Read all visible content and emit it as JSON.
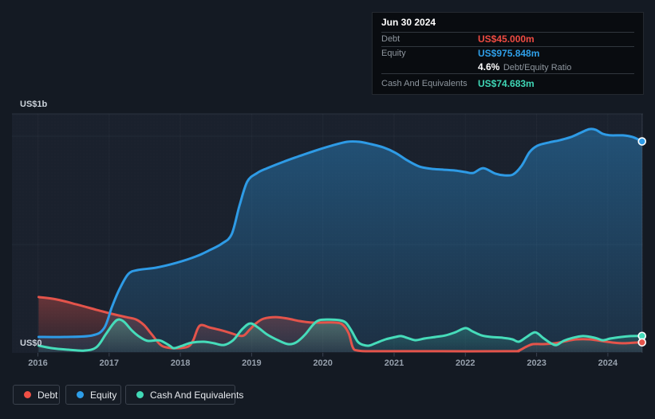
{
  "axis": {
    "y_max": "US$1b",
    "y_min": "US$0",
    "years": [
      "2016",
      "2017",
      "2018",
      "2019",
      "2020",
      "2021",
      "2022",
      "2023",
      "2024"
    ]
  },
  "tooltip": {
    "date": "Jun 30 2024",
    "debt_label": "Debt",
    "debt_value": "US$45.000m",
    "equity_label": "Equity",
    "equity_value": "US$975.848m",
    "ratio_value": "4.6%",
    "ratio_label": "Debt/Equity Ratio",
    "cash_label": "Cash And Equivalents",
    "cash_value": "US$74.683m"
  },
  "legend": {
    "items": [
      {
        "label": "Debt",
        "color": "#ef4f45"
      },
      {
        "label": "Equity",
        "color": "#2d9de8"
      },
      {
        "label": "Cash And Equivalents",
        "color": "#41d9b5"
      }
    ]
  },
  "colors": {
    "debt": "#e4544b",
    "equity": "#2e9be6",
    "cash": "#46dcba",
    "debt_text": "#ef4b42",
    "equity_text": "#2f9fe8",
    "cash_text": "#3fd6b5",
    "background": "#141a23",
    "plot_background": "#1a212d",
    "gridline": "#232b37",
    "top_gridline": "#2c3440",
    "axis_line": "#3a4351"
  },
  "chart_data": {
    "type": "area",
    "title": "Debt to Equity history",
    "xlabel": "",
    "ylabel": "",
    "x_ticks": [
      "2016",
      "2017",
      "2018",
      "2019",
      "2020",
      "2021",
      "2022",
      "2023",
      "2024"
    ],
    "y_axis": {
      "min_m": 0,
      "max_m": 1000,
      "min_label": "US$0",
      "max_label": "US$1b"
    },
    "legend_position": "bottom",
    "grid": "horizontal-faint",
    "hover_point": {
      "date": "Jun 30 2024",
      "debt_m": 45.0,
      "equity_m": 975.848,
      "debt_equity_ratio_pct": 4.6,
      "cash_m": 74.683
    },
    "series": [
      {
        "name": "Equity",
        "units": "US$m",
        "points": [
          [
            2016.01,
            70
          ],
          [
            2016.37,
            70
          ],
          [
            2016.76,
            77
          ],
          [
            2016.93,
            111
          ],
          [
            2017.04,
            210
          ],
          [
            2017.15,
            295
          ],
          [
            2017.27,
            362
          ],
          [
            2017.4,
            380
          ],
          [
            2017.66,
            391
          ],
          [
            2017.94,
            413
          ],
          [
            2018.22,
            443
          ],
          [
            2018.41,
            472
          ],
          [
            2018.58,
            502
          ],
          [
            2018.72,
            546
          ],
          [
            2018.83,
            679
          ],
          [
            2018.94,
            790
          ],
          [
            2019.08,
            830
          ],
          [
            2019.22,
            852
          ],
          [
            2019.45,
            882
          ],
          [
            2019.67,
            908
          ],
          [
            2019.9,
            934
          ],
          [
            2020.12,
            956
          ],
          [
            2020.34,
            974
          ],
          [
            2020.51,
            974
          ],
          [
            2020.68,
            963
          ],
          [
            2020.85,
            948
          ],
          [
            2021.02,
            923
          ],
          [
            2021.18,
            889
          ],
          [
            2021.35,
            860
          ],
          [
            2021.52,
            849
          ],
          [
            2021.69,
            845
          ],
          [
            2021.86,
            841
          ],
          [
            2022.0,
            834
          ],
          [
            2022.11,
            830
          ],
          [
            2022.25,
            852
          ],
          [
            2022.42,
            827
          ],
          [
            2022.55,
            819
          ],
          [
            2022.67,
            823
          ],
          [
            2022.79,
            863
          ],
          [
            2022.9,
            926
          ],
          [
            2023.01,
            956
          ],
          [
            2023.17,
            971
          ],
          [
            2023.33,
            982
          ],
          [
            2023.48,
            996
          ],
          [
            2023.63,
            1018
          ],
          [
            2023.74,
            1033
          ],
          [
            2023.83,
            1030
          ],
          [
            2023.93,
            1011
          ],
          [
            2024.04,
            1004
          ],
          [
            2024.21,
            1004
          ],
          [
            2024.35,
            996
          ],
          [
            2024.48,
            975.848
          ]
        ]
      },
      {
        "name": "Debt",
        "units": "US$m",
        "points": [
          [
            2016.01,
            255
          ],
          [
            2016.26,
            244
          ],
          [
            2016.54,
            221
          ],
          [
            2016.82,
            196
          ],
          [
            2017.04,
            177
          ],
          [
            2017.24,
            162
          ],
          [
            2017.38,
            151
          ],
          [
            2017.49,
            125
          ],
          [
            2017.6,
            81
          ],
          [
            2017.71,
            37
          ],
          [
            2017.8,
            22
          ],
          [
            2017.96,
            18
          ],
          [
            2018.11,
            26
          ],
          [
            2018.18,
            55
          ],
          [
            2018.27,
            122
          ],
          [
            2018.41,
            114
          ],
          [
            2018.55,
            103
          ],
          [
            2018.7,
            89
          ],
          [
            2018.81,
            77
          ],
          [
            2018.89,
            77
          ],
          [
            2018.97,
            103
          ],
          [
            2019.06,
            133
          ],
          [
            2019.17,
            155
          ],
          [
            2019.34,
            162
          ],
          [
            2019.51,
            155
          ],
          [
            2019.67,
            144
          ],
          [
            2019.84,
            137
          ],
          [
            2020.01,
            137
          ],
          [
            2020.16,
            137
          ],
          [
            2020.27,
            129
          ],
          [
            2020.36,
            89
          ],
          [
            2020.42,
            22
          ],
          [
            2020.49,
            7
          ],
          [
            2020.74,
            4
          ],
          [
            2021.63,
            4
          ],
          [
            2022.64,
            4
          ],
          [
            2022.75,
            7
          ],
          [
            2022.86,
            26
          ],
          [
            2022.95,
            37
          ],
          [
            2023.09,
            37
          ],
          [
            2023.26,
            41
          ],
          [
            2023.43,
            52
          ],
          [
            2023.56,
            59
          ],
          [
            2023.74,
            59
          ],
          [
            2023.9,
            52
          ],
          [
            2024.08,
            44
          ],
          [
            2024.23,
            41
          ],
          [
            2024.38,
            44
          ],
          [
            2024.48,
            45
          ]
        ]
      },
      {
        "name": "Cash And Equivalents",
        "units": "US$m",
        "points": [
          [
            2016.01,
            30
          ],
          [
            2016.2,
            18
          ],
          [
            2016.43,
            11
          ],
          [
            2016.65,
            7
          ],
          [
            2016.82,
            22
          ],
          [
            2016.95,
            81
          ],
          [
            2017.06,
            133
          ],
          [
            2017.13,
            151
          ],
          [
            2017.21,
            140
          ],
          [
            2017.32,
            100
          ],
          [
            2017.43,
            70
          ],
          [
            2017.54,
            52
          ],
          [
            2017.67,
            55
          ],
          [
            2017.73,
            52
          ],
          [
            2017.85,
            30
          ],
          [
            2017.91,
            18
          ],
          [
            2018.03,
            30
          ],
          [
            2018.16,
            44
          ],
          [
            2018.33,
            48
          ],
          [
            2018.47,
            41
          ],
          [
            2018.61,
            33
          ],
          [
            2018.74,
            55
          ],
          [
            2018.87,
            107
          ],
          [
            2018.98,
            133
          ],
          [
            2019.09,
            114
          ],
          [
            2019.22,
            81
          ],
          [
            2019.37,
            55
          ],
          [
            2019.51,
            37
          ],
          [
            2019.62,
            44
          ],
          [
            2019.75,
            81
          ],
          [
            2019.86,
            126
          ],
          [
            2019.95,
            148
          ],
          [
            2020.09,
            151
          ],
          [
            2020.23,
            148
          ],
          [
            2020.32,
            137
          ],
          [
            2020.4,
            100
          ],
          [
            2020.49,
            48
          ],
          [
            2020.57,
            33
          ],
          [
            2020.65,
            30
          ],
          [
            2020.76,
            44
          ],
          [
            2020.88,
            59
          ],
          [
            2021.02,
            70
          ],
          [
            2021.1,
            74
          ],
          [
            2021.21,
            63
          ],
          [
            2021.3,
            55
          ],
          [
            2021.43,
            63
          ],
          [
            2021.58,
            70
          ],
          [
            2021.72,
            77
          ],
          [
            2021.86,
            92
          ],
          [
            2022.0,
            111
          ],
          [
            2022.1,
            96
          ],
          [
            2022.23,
            77
          ],
          [
            2022.36,
            70
          ],
          [
            2022.53,
            66
          ],
          [
            2022.66,
            59
          ],
          [
            2022.75,
            48
          ],
          [
            2022.86,
            70
          ],
          [
            2022.98,
            92
          ],
          [
            2023.09,
            66
          ],
          [
            2023.2,
            41
          ],
          [
            2023.28,
            33
          ],
          [
            2023.38,
            52
          ],
          [
            2023.51,
            66
          ],
          [
            2023.65,
            74
          ],
          [
            2023.76,
            70
          ],
          [
            2023.85,
            63
          ],
          [
            2023.93,
            55
          ],
          [
            2024.04,
            63
          ],
          [
            2024.19,
            70
          ],
          [
            2024.32,
            74
          ],
          [
            2024.48,
            74.683
          ]
        ]
      }
    ]
  }
}
